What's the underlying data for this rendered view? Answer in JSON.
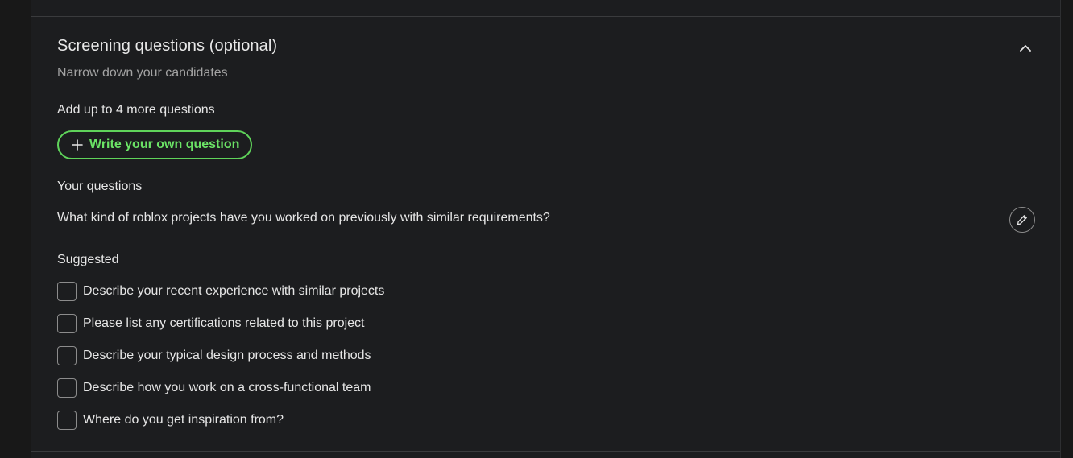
{
  "section": {
    "title": "Screening questions (optional)",
    "subtitle": "Narrow down your candidates",
    "collapse_icon": "chevron-up-icon"
  },
  "add": {
    "label": "Add up to 4 more questions",
    "button_label": "Write your own question",
    "button_icon": "plus-icon"
  },
  "your_questions": {
    "label": "Your questions",
    "items": [
      {
        "text": "What kind of roblox projects have you worked on previously with similar requirements?",
        "icon": "pencil-icon"
      }
    ]
  },
  "suggested": {
    "label": "Suggested",
    "items": [
      {
        "text": "Describe your recent experience with similar projects",
        "checked": false
      },
      {
        "text": "Please list any certifications related to this project",
        "checked": false
      },
      {
        "text": "Describe your typical design process and methods",
        "checked": false
      },
      {
        "text": "Describe how you work on a cross-functional team",
        "checked": false
      },
      {
        "text": "Where do you get inspiration from?",
        "checked": false
      }
    ]
  },
  "colors": {
    "background": "#181818",
    "panel": "#1c1d1f",
    "accent": "#6be366",
    "text": "#e6e6e6",
    "muted": "#a3a3a3"
  }
}
